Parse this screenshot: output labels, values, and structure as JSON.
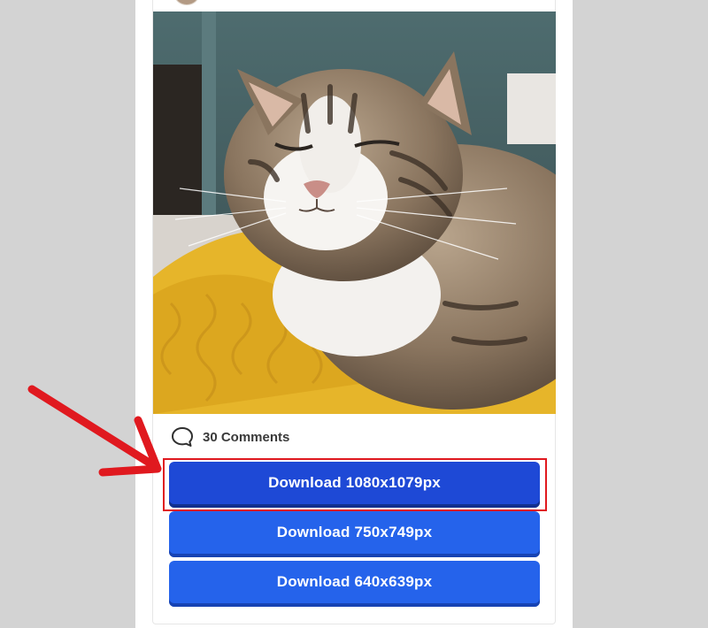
{
  "post": {
    "photo_alt": "Tabby cat on a yellow knit blanket",
    "comments": {
      "icon": "speech-bubble-icon",
      "label": "30 Comments"
    }
  },
  "downloads": [
    {
      "label": "Download 1080x1079px",
      "highlighted": true
    },
    {
      "label": "Download 750x749px",
      "highlighted": false
    },
    {
      "label": "Download 640x639px",
      "highlighted": false
    }
  ],
  "annotation": {
    "arrow_icon": "red-pointer-arrow",
    "highlight_color": "#e0191f"
  },
  "colors": {
    "page_background": "#d3d3d3",
    "primary_button": "#1e49d6",
    "secondary_button": "#2563eb",
    "arrow": "#e0191f"
  }
}
